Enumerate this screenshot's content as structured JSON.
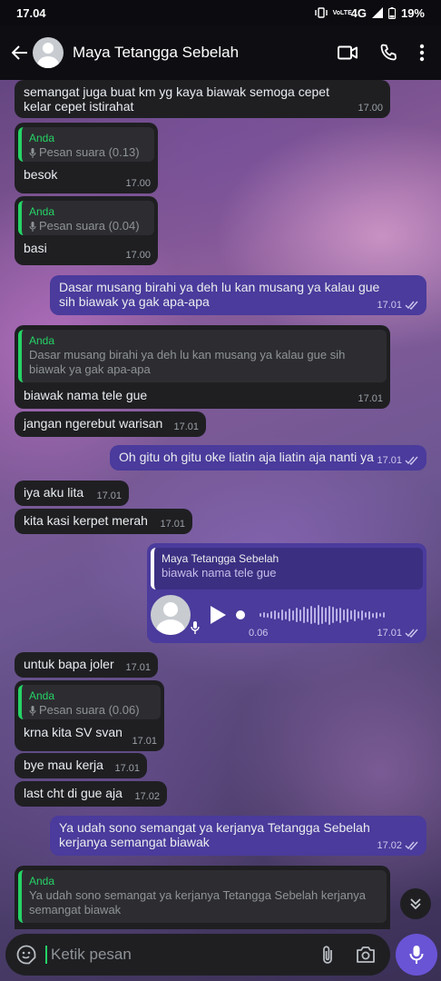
{
  "status": {
    "time": "17.04",
    "network": "4G",
    "battery": "19%",
    "volte": "VoLTE"
  },
  "header": {
    "contact_name": "Maya Tetangga Sebelah"
  },
  "messages": {
    "m1": {
      "text": "semangat juga buat km yg kaya biawak semoga cepet kelar cepet istirahat",
      "time": "17.00"
    },
    "m2": {
      "quote_name": "Anda",
      "quote_text": "Pesan suara (0.13)",
      "text": "besok",
      "time": "17.00"
    },
    "m3": {
      "quote_name": "Anda",
      "quote_text": "Pesan suara (0.04)",
      "text": "basi",
      "time": "17.00"
    },
    "m4": {
      "text": "Dasar musang birahi ya deh lu kan musang ya kalau gue sih biawak ya gak apa-apa",
      "time": "17.01"
    },
    "m5": {
      "quote_name": "Anda",
      "quote_text": "Dasar musang birahi ya deh lu kan musang ya kalau gue sih biawak ya gak apa-apa",
      "text": "biawak nama tele gue",
      "time": "17.01"
    },
    "m6": {
      "text": "jangan ngerebut warisan",
      "time": "17.01"
    },
    "m7": {
      "text": "Oh gitu oh gitu oke liatin aja liatin aja nanti ya",
      "time": "17.01"
    },
    "m8": {
      "text": "iya aku lita",
      "time": "17.01"
    },
    "m9": {
      "text": "kita kasi kerpet merah",
      "time": "17.01"
    },
    "m10": {
      "quote_name": "Maya Tetangga Sebelah",
      "quote_text": "biawak nama tele gue",
      "duration": "0.06",
      "time": "17.01"
    },
    "m11": {
      "text": "untuk bapa joler",
      "time": "17.01"
    },
    "m12": {
      "quote_name": "Anda",
      "quote_text": "Pesan suara (0.06)",
      "text": "krna kita SV svan",
      "time": "17.01"
    },
    "m13": {
      "text": "bye mau kerja",
      "time": "17.01"
    },
    "m14": {
      "text": "last cht di gue aja",
      "time": "17.02"
    },
    "m15": {
      "text": "Ya udah sono semangat ya kerjanya Tetangga Sebelah kerjanya semangat biawak",
      "time": "17.02"
    },
    "m16": {
      "quote_name": "Anda",
      "quote_text": "Ya udah sono semangat ya kerjanya Tetangga Sebelah kerjanya semangat biawak"
    }
  },
  "composer": {
    "placeholder": "Ketik pesan"
  },
  "icons": {
    "back": "arrow-left-icon",
    "video": "video-camera-icon",
    "call": "phone-icon",
    "menu": "more-vertical-icon",
    "emoji": "sticker-icon",
    "attach": "paperclip-icon",
    "camera": "camera-icon",
    "mic": "microphone-icon",
    "scroll": "double-chevron-down-icon",
    "read": "double-check-icon"
  },
  "colors": {
    "incoming": "#1f1f22",
    "outgoing": "#4a3b9c",
    "quote_accent": "#25d366",
    "send": "#6a54d6"
  }
}
